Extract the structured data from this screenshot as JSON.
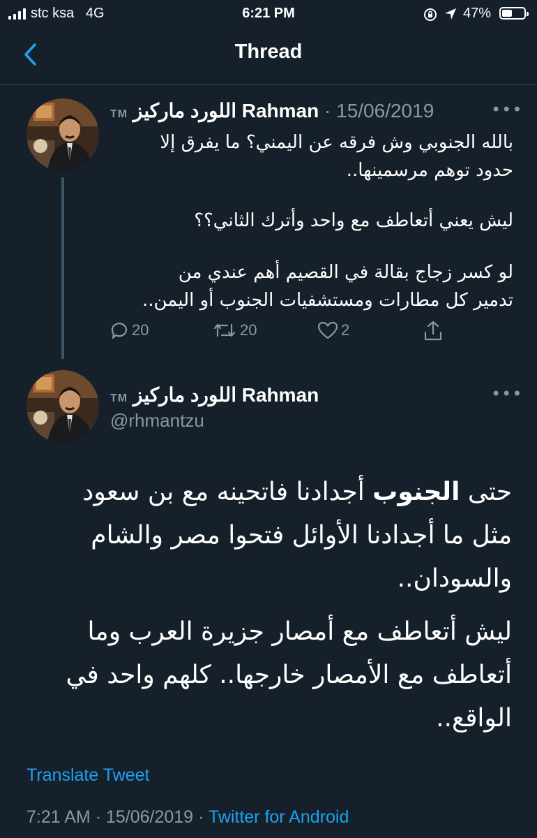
{
  "status_bar": {
    "carrier": "stc ksa",
    "network": "4G",
    "time": "6:21 PM",
    "battery_percent": "47%",
    "battery_level": 0.47
  },
  "header": {
    "title": "Thread"
  },
  "tweet_original": {
    "tm": "TM",
    "display_name": "اللورد ماركيز Rahman",
    "separator": "·",
    "date": "15/06/2019",
    "text_lines": [
      "بالله الجنوبي وش فرقه عن اليمني؟ ما يفرق إلا",
      "حدود توهم مرسمينها..",
      "ليش يعني أتعاطف مع واحد وأترك الثاني؟؟",
      "لو كسر زجاج بقالة في القصيم أهم عندي من",
      "تدمير كل مطارات ومستشفيات الجنوب أو اليمن.."
    ],
    "replies": "20",
    "retweets": "20",
    "likes": "2"
  },
  "tweet_main": {
    "tm": "TM",
    "display_name": "اللورد ماركيز Rahman",
    "handle": "@rhmantzu",
    "line1_start": "حتى ",
    "line1_bold": "الجنوب",
    "line1_end": " أجدادنا فاتحينه مع بن سعود",
    "line2": "مثل ما أجدادنا الأوائل فتحوا مصر والشام",
    "line3": "والسودان..",
    "line4": "ليش أتعاطف مع أمصار جزيرة العرب وما",
    "line5": "أتعاطف مع الأمصار خارجها.. كلهم واحد في",
    "line6": "الواقع..",
    "translate": "Translate Tweet",
    "time": "7:21 AM",
    "sep": "·",
    "date": "15/06/2019",
    "source": "Twitter for Android"
  },
  "icons": {
    "back": "chevron-left-icon",
    "more": "more-icon",
    "reply": "reply-icon",
    "retweet": "retweet-icon",
    "like": "heart-icon",
    "share": "share-icon"
  },
  "colors": {
    "background": "#15202b",
    "accent": "#1da1f2",
    "secondary_text": "#8899a6",
    "divider": "#38444d"
  }
}
